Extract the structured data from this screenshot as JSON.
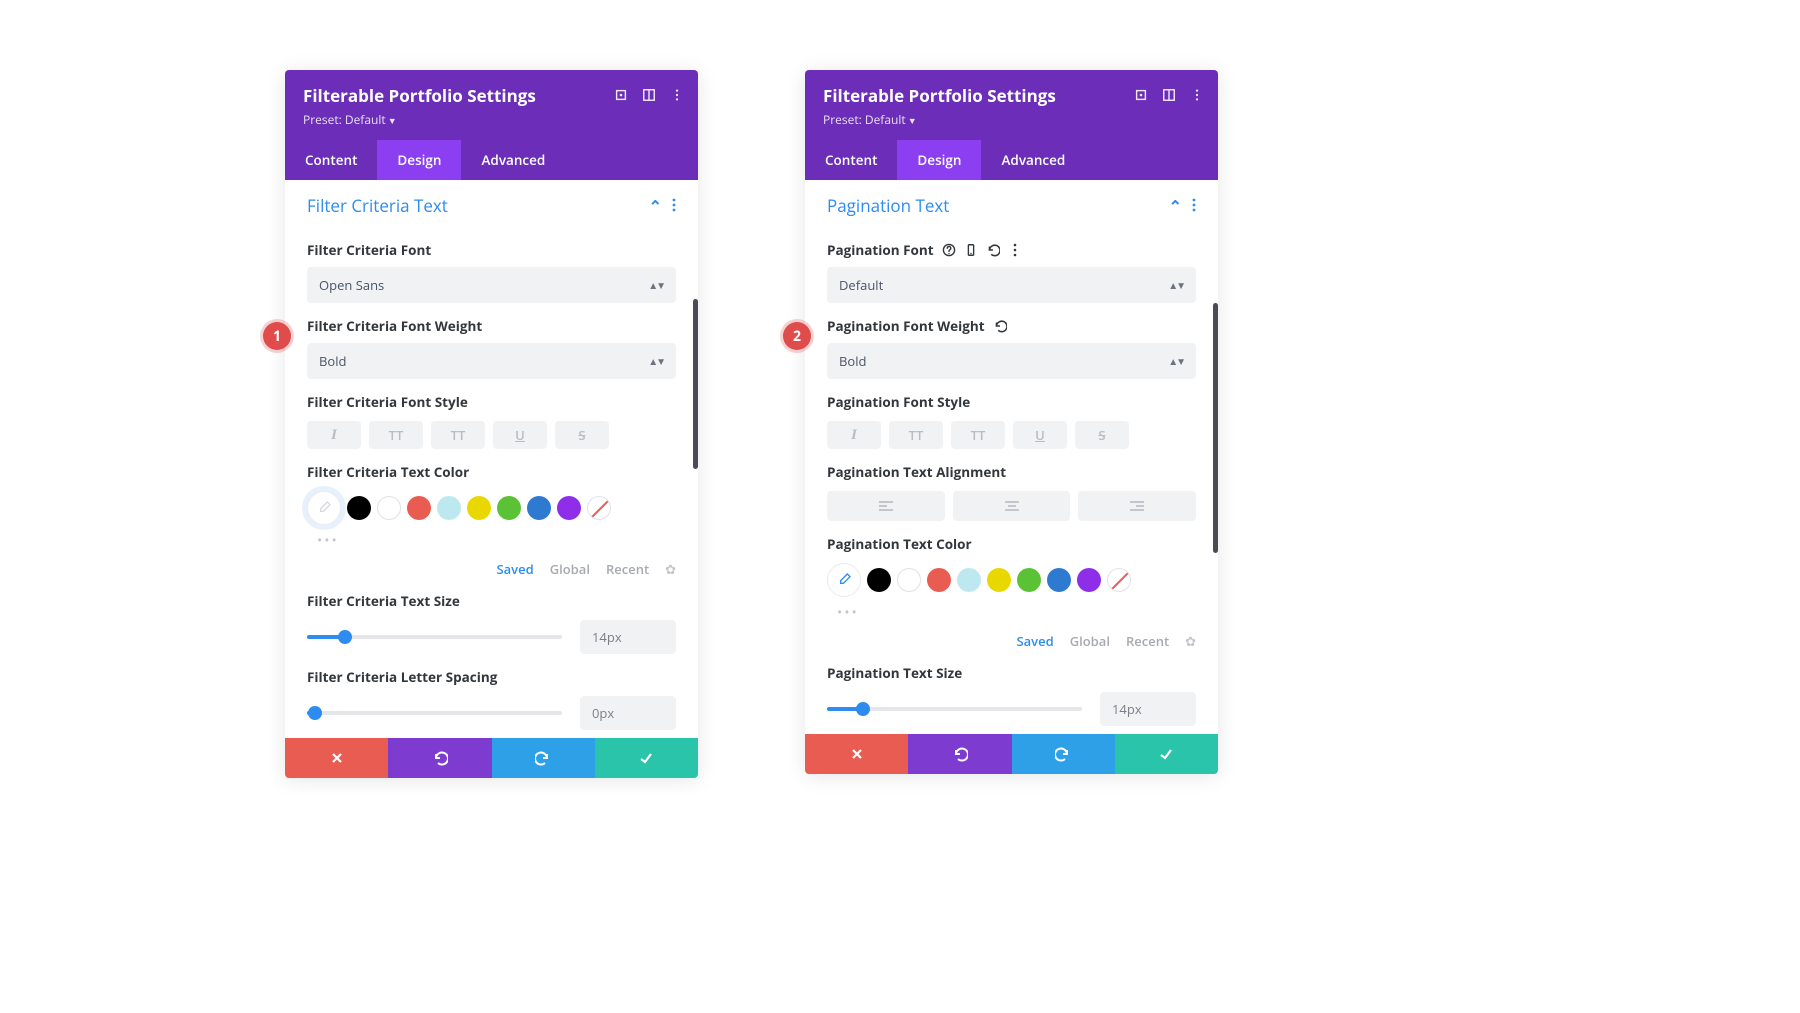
{
  "settings_title": "Filterable Portfolio Settings",
  "preset_label": "Preset: Default",
  "tabs": {
    "content": "Content",
    "design": "Design",
    "advanced": "Advanced"
  },
  "color_tabs": {
    "saved": "Saved",
    "global": "Global",
    "recent": "Recent"
  },
  "swatches": [
    "#000000",
    "#ffffff",
    "#e85c52",
    "#bde8f0",
    "#e8d800",
    "#5bc236",
    "#2e7ad0",
    "#8e2ee8"
  ],
  "badges": {
    "one": "1",
    "two": "2"
  },
  "panel1": {
    "section_title": "Filter Criteria Text",
    "font_label": "Filter Criteria Font",
    "font_value": "Open Sans",
    "weight_label": "Filter Criteria Font Weight",
    "weight_value": "Bold",
    "style_label": "Filter Criteria Font Style",
    "color_label": "Filter Criteria Text Color",
    "size_label": "Filter Criteria Text Size",
    "size_value": "14px",
    "spacing_label": "Filter Criteria Letter Spacing",
    "spacing_value": "0px"
  },
  "panel2": {
    "section_title": "Pagination Text",
    "font_label": "Pagination Font",
    "font_value": "Default",
    "weight_label": "Pagination Font Weight",
    "weight_value": "Bold",
    "style_label": "Pagination Font Style",
    "align_label": "Pagination Text Alignment",
    "color_label": "Pagination Text Color",
    "size_label": "Pagination Text Size",
    "size_value": "14px"
  }
}
